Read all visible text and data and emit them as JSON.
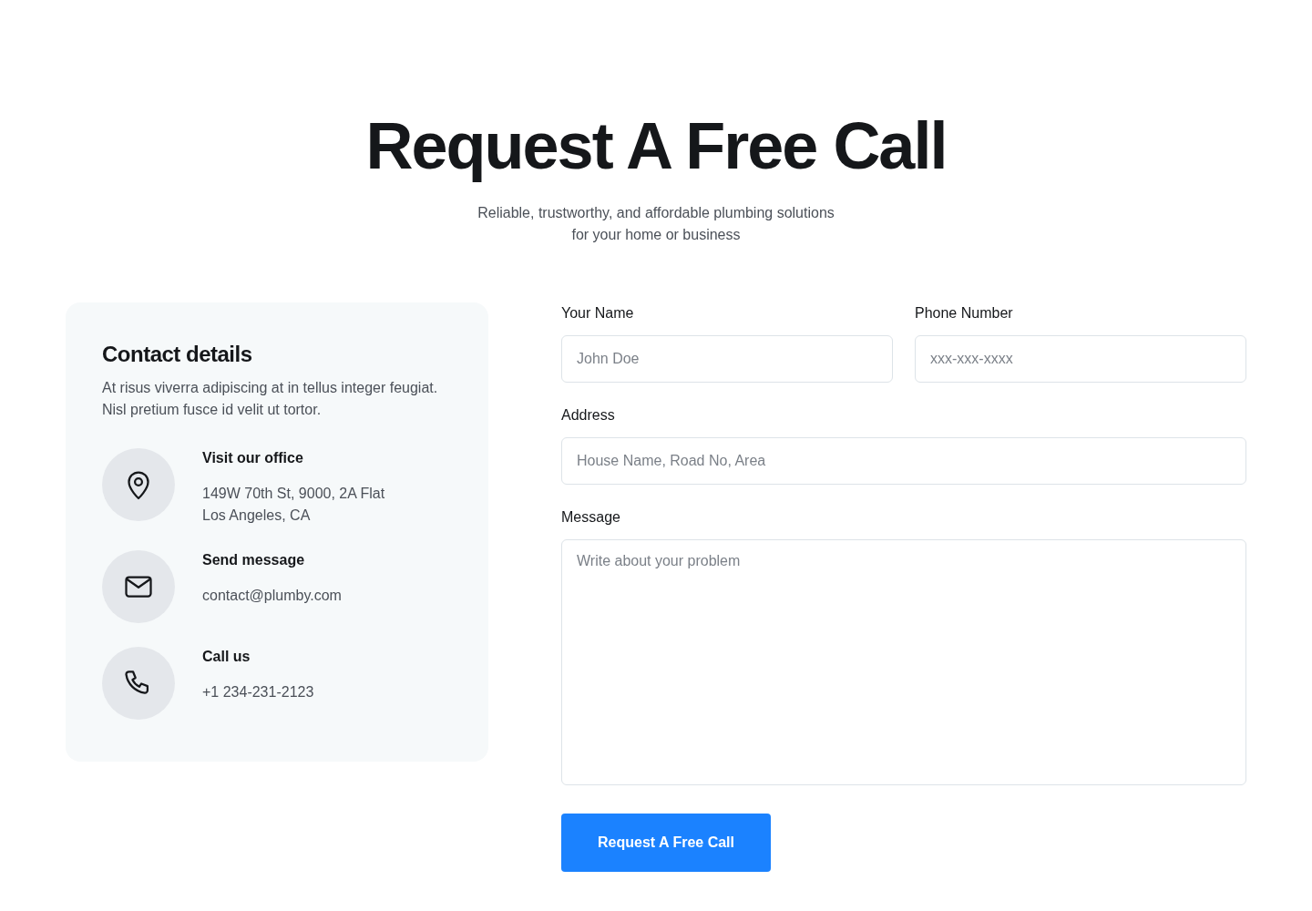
{
  "hero": {
    "title": "Request A Free Call",
    "subtitle_lines": [
      "Reliable, trustworthy, and affordable plumbing solutions",
      "for your home or business"
    ]
  },
  "contact_card": {
    "title": "Contact details",
    "description_lines": [
      "At risus viverra adipiscing at in tellus integer feugiat.",
      "Nisl pretium fusce id velit ut tortor."
    ],
    "items": [
      {
        "title": "Visit our office",
        "lines": [
          "149W 70th St, 9000, 2A Flat",
          "Los Angeles, CA"
        ]
      },
      {
        "title": "Send message",
        "lines": [
          "contact@plumby.com"
        ]
      },
      {
        "title": "Call us",
        "lines": [
          "+1 234-231-2123"
        ]
      }
    ]
  },
  "form": {
    "rows": [
      [
        {
          "kind": "input",
          "label": "Your Name",
          "placeholder": "John Doe"
        },
        {
          "kind": "input",
          "label": "Phone Number",
          "placeholder": "xxx-xxx-xxxx"
        }
      ],
      [
        {
          "kind": "input",
          "label": "Address",
          "placeholder": "House Name, Road No, Area"
        }
      ],
      [
        {
          "kind": "textarea",
          "label": "Message",
          "placeholder": "Write about your problem"
        }
      ]
    ],
    "submit": "Request A Free Call"
  }
}
